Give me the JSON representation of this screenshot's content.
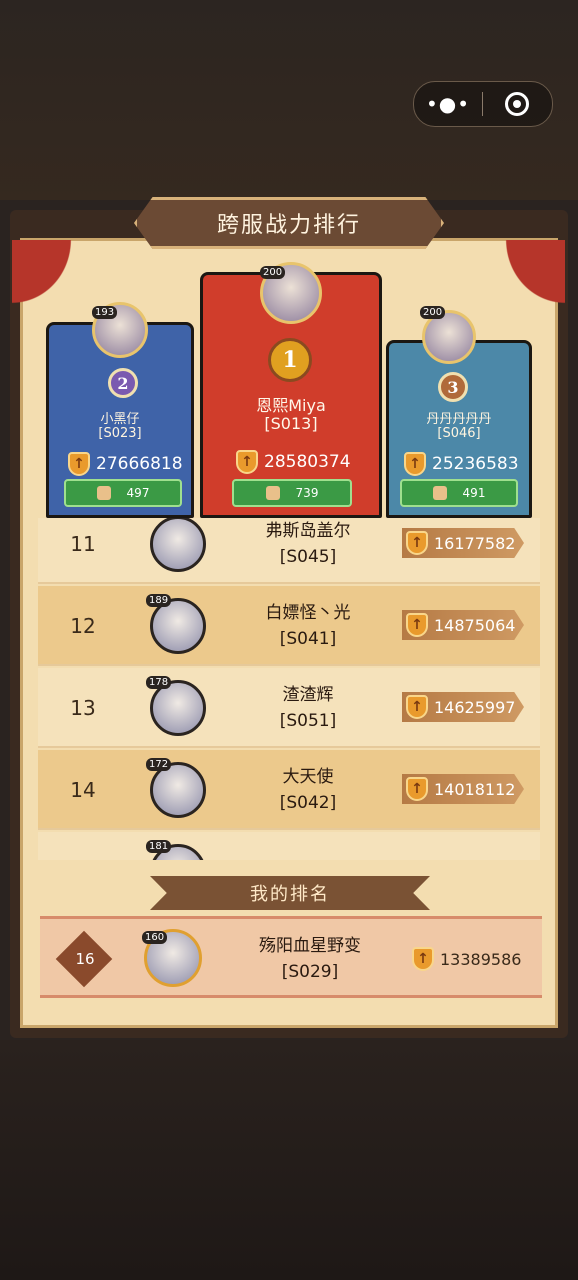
{
  "capsule": {
    "more_label": "•●•"
  },
  "title": "跨服战力排行",
  "podium": [
    {
      "rank": "2",
      "level": "193",
      "name": "小黑仔",
      "server": "[S023]",
      "power": "27666818",
      "likes": "497"
    },
    {
      "rank": "1",
      "level": "200",
      "name": "恩熙Miya",
      "server": "[S013]",
      "power": "28580374",
      "likes": "739"
    },
    {
      "rank": "3",
      "level": "200",
      "name": "丹丹丹丹丹",
      "server": "[S046]",
      "power": "25236583",
      "likes": "491"
    }
  ],
  "list": [
    {
      "rank": "11",
      "level": "",
      "name": "弗斯岛盖尔",
      "server": "[S045]",
      "power": "16177582"
    },
    {
      "rank": "12",
      "level": "189",
      "name": "白嫖怪丶光",
      "server": "[S041]",
      "power": "14875064"
    },
    {
      "rank": "13",
      "level": "178",
      "name": "渣渣辉",
      "server": "[S051]",
      "power": "14625997"
    },
    {
      "rank": "14",
      "level": "172",
      "name": "大天使",
      "server": "[S042]",
      "power": "14018112"
    },
    {
      "rank": "",
      "level": "181",
      "name": "",
      "server": "",
      "power": ""
    }
  ],
  "my_rank": {
    "banner": "我的排名",
    "rank": "16",
    "level": "160",
    "name": "殇阳血星野变",
    "server": "[S029]",
    "power": "13389586"
  },
  "colors": {
    "first": "#d03d2b",
    "second": "#3f63a8",
    "third": "#4c88a8",
    "parchment": "#f3ddb0"
  }
}
